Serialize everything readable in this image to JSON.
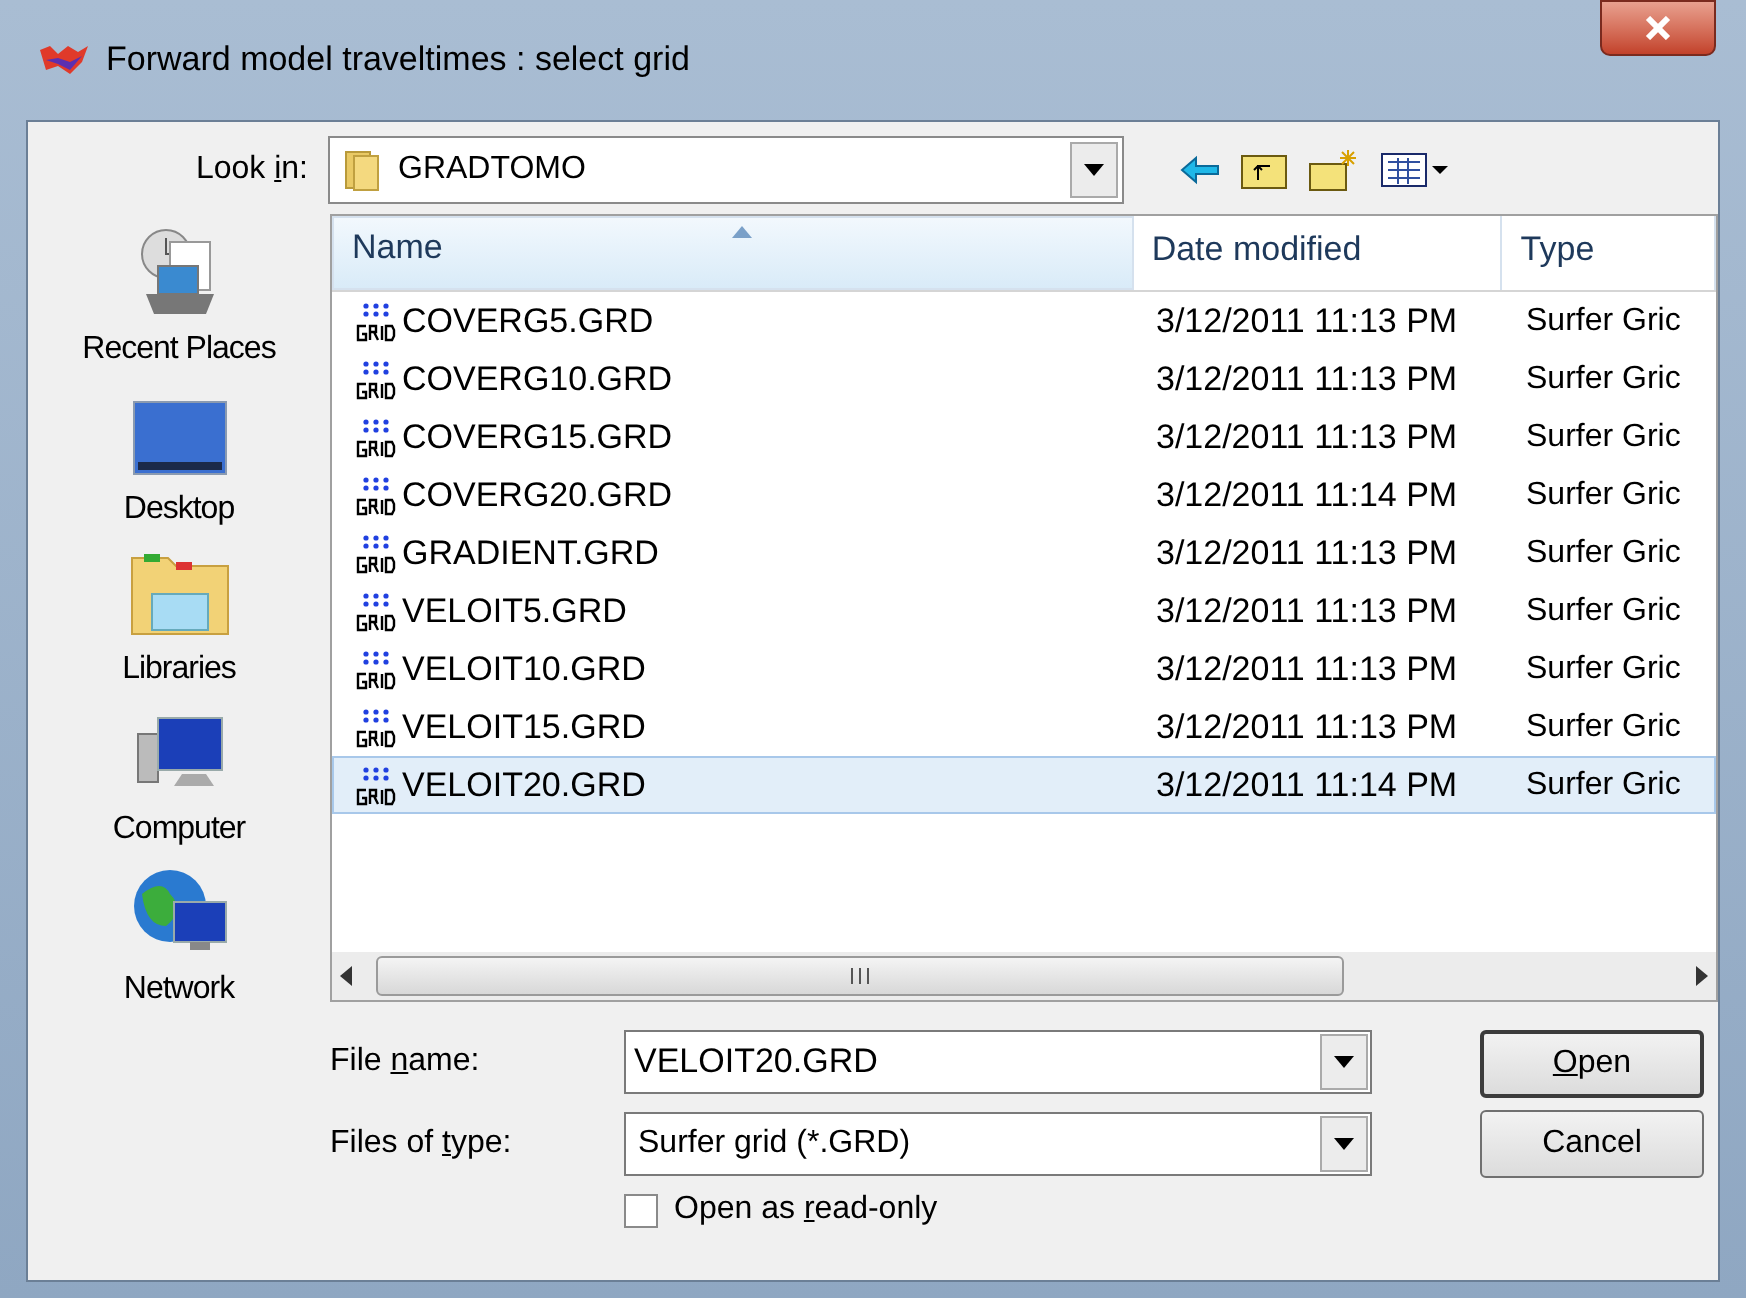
{
  "window": {
    "title": "Forward model traveltimes : select grid"
  },
  "look_in": {
    "label": [
      {
        "text": "Look ",
        "underlined": false
      },
      {
        "text": "i",
        "underlined": true
      },
      {
        "text": "n:",
        "underlined": false
      }
    ],
    "value": "GRADTOMO"
  },
  "places": [
    {
      "label": "Recent Places",
      "kind": "recent"
    },
    {
      "label": "Desktop",
      "kind": "desktop"
    },
    {
      "label": "Libraries",
      "kind": "libraries"
    },
    {
      "label": "Computer",
      "kind": "computer"
    },
    {
      "label": "Network",
      "kind": "network"
    }
  ],
  "table": {
    "columns": [
      {
        "label": "Name",
        "sorted": true,
        "hover": true
      },
      {
        "label": "Date modified",
        "sorted": false,
        "hover": false
      },
      {
        "label": "Type",
        "sorted": false,
        "hover": false
      }
    ],
    "rows": [
      {
        "name": "COVERG5.GRD",
        "date": "3/12/2011 11:13 PM",
        "type": "Surfer Gric",
        "selected": false
      },
      {
        "name": "COVERG10.GRD",
        "date": "3/12/2011 11:13 PM",
        "type": "Surfer Gric",
        "selected": false
      },
      {
        "name": "COVERG15.GRD",
        "date": "3/12/2011 11:13 PM",
        "type": "Surfer Gric",
        "selected": false
      },
      {
        "name": "COVERG20.GRD",
        "date": "3/12/2011 11:14 PM",
        "type": "Surfer Gric",
        "selected": false
      },
      {
        "name": "GRADIENT.GRD",
        "date": "3/12/2011 11:13 PM",
        "type": "Surfer Gric",
        "selected": false
      },
      {
        "name": "VELOIT5.GRD",
        "date": "3/12/2011 11:13 PM",
        "type": "Surfer Gric",
        "selected": false
      },
      {
        "name": "VELOIT10.GRD",
        "date": "3/12/2011 11:13 PM",
        "type": "Surfer Gric",
        "selected": false
      },
      {
        "name": "VELOIT15.GRD",
        "date": "3/12/2011 11:13 PM",
        "type": "Surfer Gric",
        "selected": false
      },
      {
        "name": "VELOIT20.GRD",
        "date": "3/12/2011 11:14 PM",
        "type": "Surfer Gric",
        "selected": true
      }
    ]
  },
  "file_name": {
    "label": [
      {
        "text": "File ",
        "underlined": false
      },
      {
        "text": "n",
        "underlined": true
      },
      {
        "text": "ame:",
        "underlined": false
      }
    ],
    "value": "VELOIT20.GRD"
  },
  "file_type": {
    "label": [
      {
        "text": "Files of ",
        "underlined": false
      },
      {
        "text": "t",
        "underlined": true
      },
      {
        "text": "ype:",
        "underlined": false
      }
    ],
    "value": "Surfer grid (*.GRD)"
  },
  "read_only": {
    "label": [
      {
        "text": "Open as ",
        "underlined": false
      },
      {
        "text": "r",
        "underlined": true
      },
      {
        "text": "ead-only",
        "underlined": false
      }
    ],
    "checked": false
  },
  "buttons": [
    {
      "label": [
        {
          "text": "O",
          "underlined": true
        },
        {
          "text": "pen",
          "underlined": false
        }
      ],
      "default": true
    },
    {
      "label": [
        {
          "text": "Cancel",
          "underlined": false
        }
      ],
      "default": false
    }
  ]
}
